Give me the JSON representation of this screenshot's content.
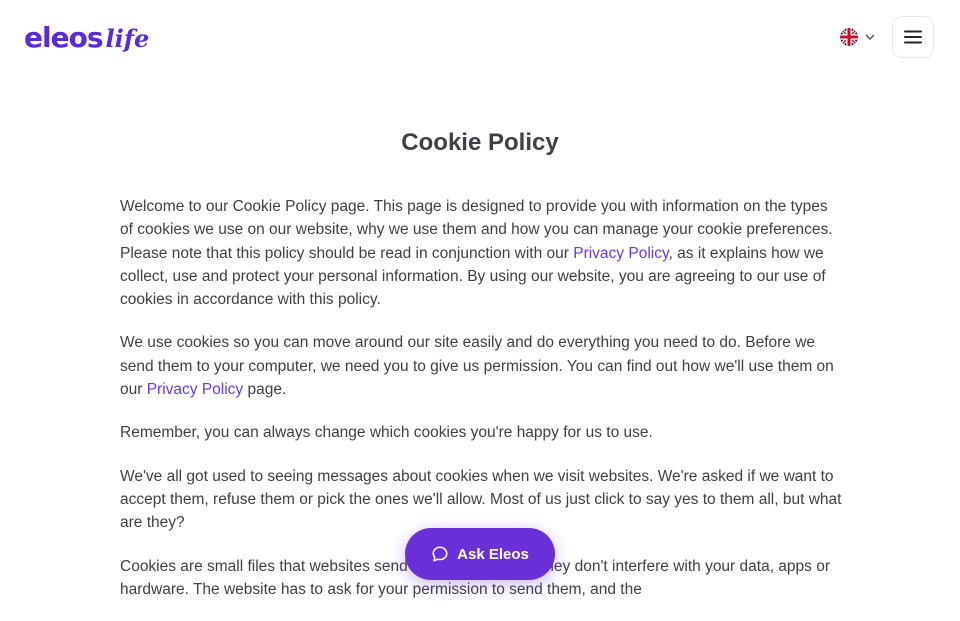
{
  "header": {
    "logo_main": "eleos",
    "logo_sub": "life",
    "language_icon": "uk-flag-icon",
    "language_chevron_icon": "chevron-down-icon",
    "menu_icon": "hamburger-menu-icon"
  },
  "page": {
    "title": "Cookie Policy"
  },
  "content": {
    "p1_text_a": "Welcome to our Cookie Policy page. This page is designed to provide you with information on the types of cookies we use on our website, why we use them and how you can manage your cookie preferences. Please note that this policy should be read in conjunction with our ",
    "p1_link": "Privacy Policy",
    "p1_text_b": ", as it explains how we collect, use and protect your personal information. By using our website, you are agreeing to our use of cookies in accordance with this policy.",
    "p2_text_a": "We use cookies so you can move around our site easily and do everything you need to do. Before we send them to your computer, we need you to give us permission. You can find out how we'll use them on our ",
    "p2_link": "Privacy Policy",
    "p2_text_b": " page.",
    "p3_text": "Remember, you can always change which cookies you're happy for us to use.",
    "p4_text": "We've all got used to seeing messages about cookies when we visit websites. We're asked if we want to accept them, refuse them or pick the ones we'll allow. Most of us just click to say yes to them all, but what are they?",
    "p5_text": "Cookies are small files that websites send to your computer. They don't interfere with your data, apps or hardware. The website has to ask for your permission to send them, and the"
  },
  "ask_button": {
    "label": "Ask Eleos",
    "icon": "chat-bubble-icon"
  },
  "colors": {
    "brand": "#5b2bd6",
    "link": "#6d3bd9",
    "button_bg": "#6a2fd6",
    "text": "#3f3f46"
  }
}
